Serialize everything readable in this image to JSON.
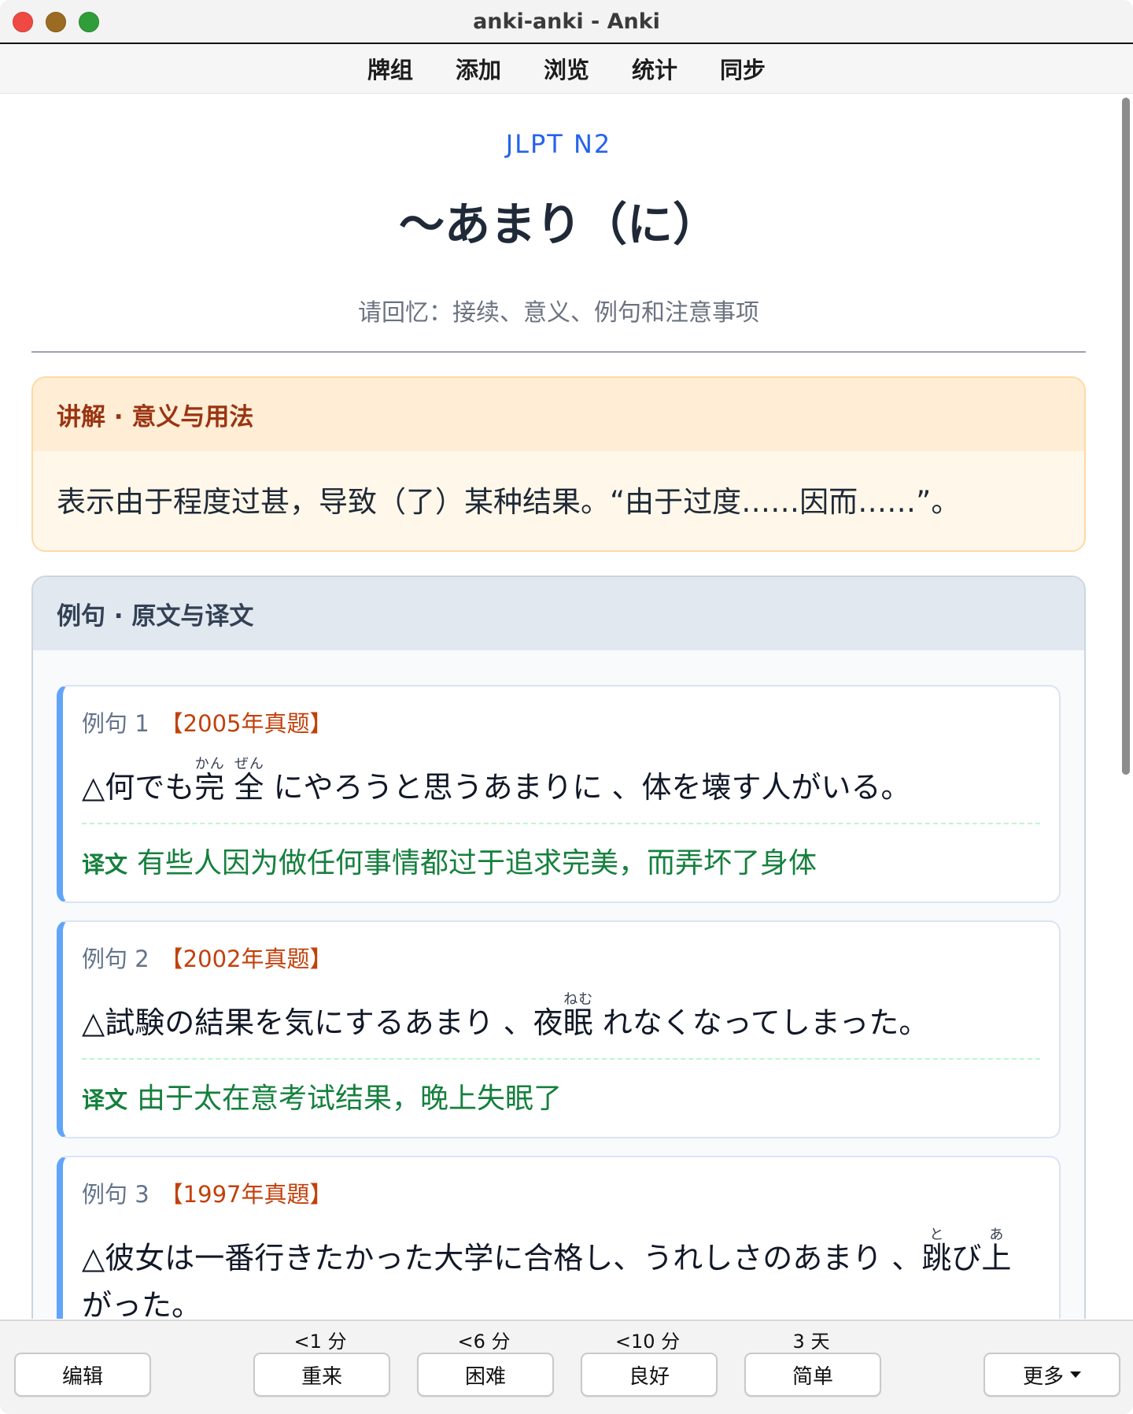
{
  "window": {
    "title": "anki-anki - Anki"
  },
  "topmenu": {
    "items": [
      "牌组",
      "添加",
      "浏览",
      "统计",
      "同步"
    ]
  },
  "card": {
    "level": "JLPT N2",
    "grammar": "～あまり（に）",
    "prompt": "请回忆：接续、意义、例句和注意事项",
    "explain": {
      "header": "讲解 · 意义与用法",
      "text": "表示由于程度过甚，导致（了）某种结果。“由于过度……因而……”。"
    },
    "examples": {
      "header": "例句 · 原文与译文",
      "translation_tag": "译文",
      "items": [
        {
          "label": "例句 1",
          "year": "【2005年真题】",
          "jp": {
            "pre": "△何でも",
            "r1_base": "完",
            "r1_rt": "かん",
            "r2_base": "全",
            "r2_rt": "ぜん",
            "post": "にやろうと思うあまりに 、体を壊す人がいる。"
          },
          "cn": "有些人因为做任何事情都过于追求完美，而弄坏了身体"
        },
        {
          "label": "例句 2",
          "year": "【2002年真题】",
          "jp": {
            "pre": "△試験の結果を気にするあまり 、夜",
            "r1_base": "眠",
            "r1_rt": "ねむ",
            "post": "れなくなってしまった。"
          },
          "cn": "由于太在意考试结果，晚上失眠了"
        },
        {
          "label": "例句 3",
          "year": "【1997年真題】",
          "jp": {
            "pre": "△彼女は一番行きたかった大学に合格し、うれしさのあまり 、",
            "r1_base": "跳",
            "r1_rt": "と",
            "mid": "び",
            "r2_base": "上",
            "r2_rt": "あ",
            "post": "がった。"
          }
        }
      ]
    }
  },
  "bottombar": {
    "edit": "编辑",
    "more": "更多",
    "answers": [
      {
        "label": "重来",
        "interval": "<1 分"
      },
      {
        "label": "困难",
        "interval": "<6 分"
      },
      {
        "label": "良好",
        "interval": "<10 分"
      },
      {
        "label": "简单",
        "interval": "3 天"
      }
    ]
  }
}
